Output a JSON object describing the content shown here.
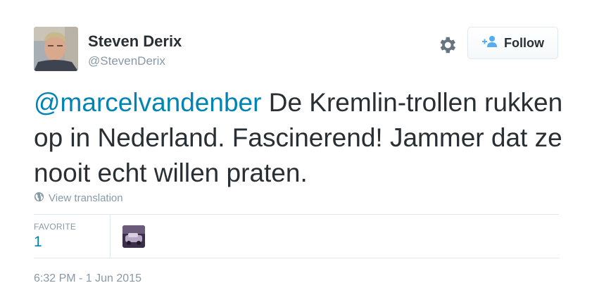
{
  "author": {
    "name": "Steven Derix",
    "handle": "@StevenDerix",
    "avatar_icon": "user-photo"
  },
  "actions": {
    "settings_icon": "gear-icon",
    "follow_icon": "add-user-icon",
    "follow_label": "Follow"
  },
  "tweet": {
    "mention": "@marcelvandenber",
    "text": " De Kremlin-trollen rukken op in Nederland. Fascinerend! Jammer dat ze nooit echt willen praten."
  },
  "translation": {
    "icon": "globe-icon",
    "label": "View translation"
  },
  "stats": {
    "favorite_label": "FAVORITE",
    "favorite_count": "1"
  },
  "timestamp": "6:32 PM - 1 Jun 2015",
  "colors": {
    "link": "#0084b4",
    "muted": "#8899a6",
    "text": "#292f33",
    "border": "#e1e8ed"
  }
}
